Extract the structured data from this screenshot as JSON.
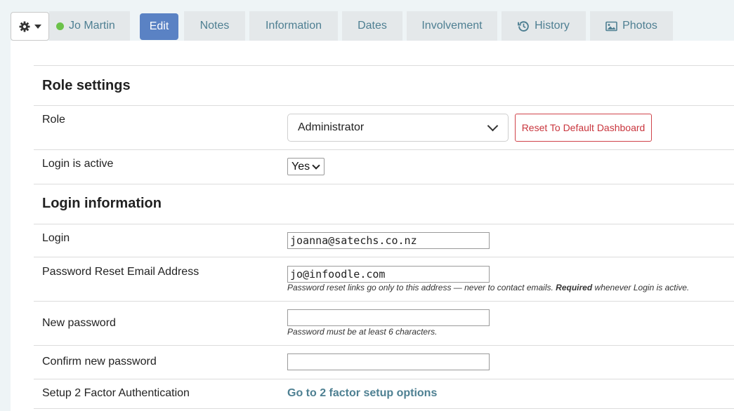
{
  "tabs": {
    "user_name": "Jo Martin",
    "edit": "Edit",
    "notes": "Notes",
    "information": "Information",
    "dates": "Dates",
    "involvement": "Involvement",
    "history": "History",
    "photos": "Photos"
  },
  "role_settings": {
    "title": "Role settings",
    "role_label": "Role",
    "role_value": "Administrator",
    "reset_button": "Reset To Default Dashboard",
    "login_active_label": "Login is active",
    "login_active_value": "Yes"
  },
  "login_information": {
    "title": "Login information",
    "login_label": "Login",
    "login_value": "joanna@satechs.co.nz",
    "reset_email_label": "Password Reset Email Address",
    "reset_email_value": "jo@infoodle.com",
    "reset_email_help_pre": "Password reset links go only to this address — never to contact emails. ",
    "reset_email_help_bold": "Required",
    "reset_email_help_post": " whenever Login is active.",
    "new_password_label": "New password",
    "new_password_value": "",
    "new_password_help": "Password must be at least 6 characters.",
    "confirm_password_label": "Confirm new password",
    "confirm_password_value": "",
    "two_factor_label": "Setup 2 Factor Authentication",
    "two_factor_link": "Go to 2 factor setup options"
  },
  "colors": {
    "accent": "#5a82c4",
    "link": "#4e8092",
    "danger": "#c9353d",
    "status": "#6cc24a"
  },
  "icons": [
    "gear-icon",
    "caret-down-icon",
    "history-icon",
    "image-icon",
    "chevron-down-icon"
  ]
}
